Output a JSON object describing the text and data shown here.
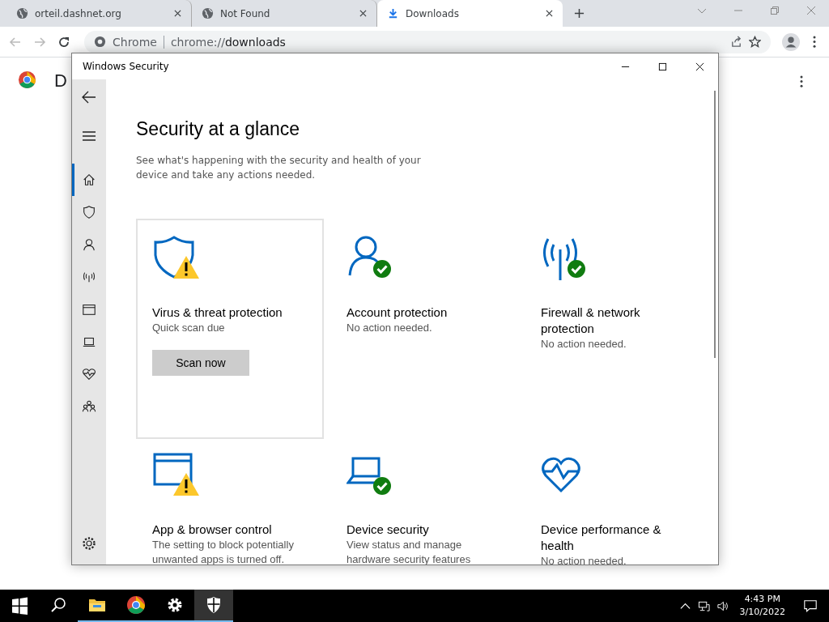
{
  "browser": {
    "tabs": [
      {
        "title": "orteil.dashnet.org",
        "kind": "globe",
        "selected": false
      },
      {
        "title": "Not Found",
        "kind": "globe",
        "selected": false
      },
      {
        "title": "Downloads",
        "kind": "download",
        "selected": true
      }
    ],
    "address": {
      "site": "Chrome",
      "url_prefix": "chrome://",
      "url_main": "downloads"
    },
    "page_title": "D"
  },
  "window": {
    "title": "Windows Security",
    "sidebar": [
      {
        "kind": "home",
        "selected": true
      },
      {
        "kind": "shield",
        "selected": false
      },
      {
        "kind": "person",
        "selected": false
      },
      {
        "kind": "wifi",
        "selected": false
      },
      {
        "kind": "browser",
        "selected": false
      },
      {
        "kind": "laptop",
        "selected": false
      },
      {
        "kind": "heart",
        "selected": false
      },
      {
        "kind": "family",
        "selected": false
      }
    ],
    "heading": "Security at a glance",
    "intro": "See what's happening with the security and health of your device and take any actions needed.",
    "cards": [
      {
        "kind": "shield",
        "warning": true,
        "ok": false,
        "title": "Virus & threat protection",
        "text": "Quick scan due",
        "button": "Scan now",
        "focused": true
      },
      {
        "kind": "person",
        "warning": false,
        "ok": true,
        "title": "Account protection",
        "text": "No action needed.",
        "focused": false
      },
      {
        "kind": "wifi",
        "warning": false,
        "ok": true,
        "title": "Firewall & network protection",
        "text": "No action needed.",
        "focused": false
      },
      {
        "kind": "browser",
        "warning": true,
        "ok": false,
        "title": "App & browser control",
        "text": "The setting to block potentially unwanted apps is turned off.",
        "focused": false
      },
      {
        "kind": "laptop",
        "warning": false,
        "ok": true,
        "title": "Device security",
        "text": "View status and manage hardware security features",
        "focused": false
      },
      {
        "kind": "heart",
        "warning": false,
        "ok": false,
        "title": "Device performance & health",
        "text": "No action needed.",
        "focused": false
      }
    ]
  },
  "taskbar": {
    "apps": [
      {
        "kind": "folder",
        "running": true,
        "selected": false
      },
      {
        "kind": "chrome",
        "running": true,
        "selected": false
      },
      {
        "kind": "gear",
        "running": true,
        "selected": false
      },
      {
        "kind": "shield",
        "running": true,
        "selected": true
      }
    ],
    "time": "4:43 PM",
    "date": "3/10/2022"
  }
}
